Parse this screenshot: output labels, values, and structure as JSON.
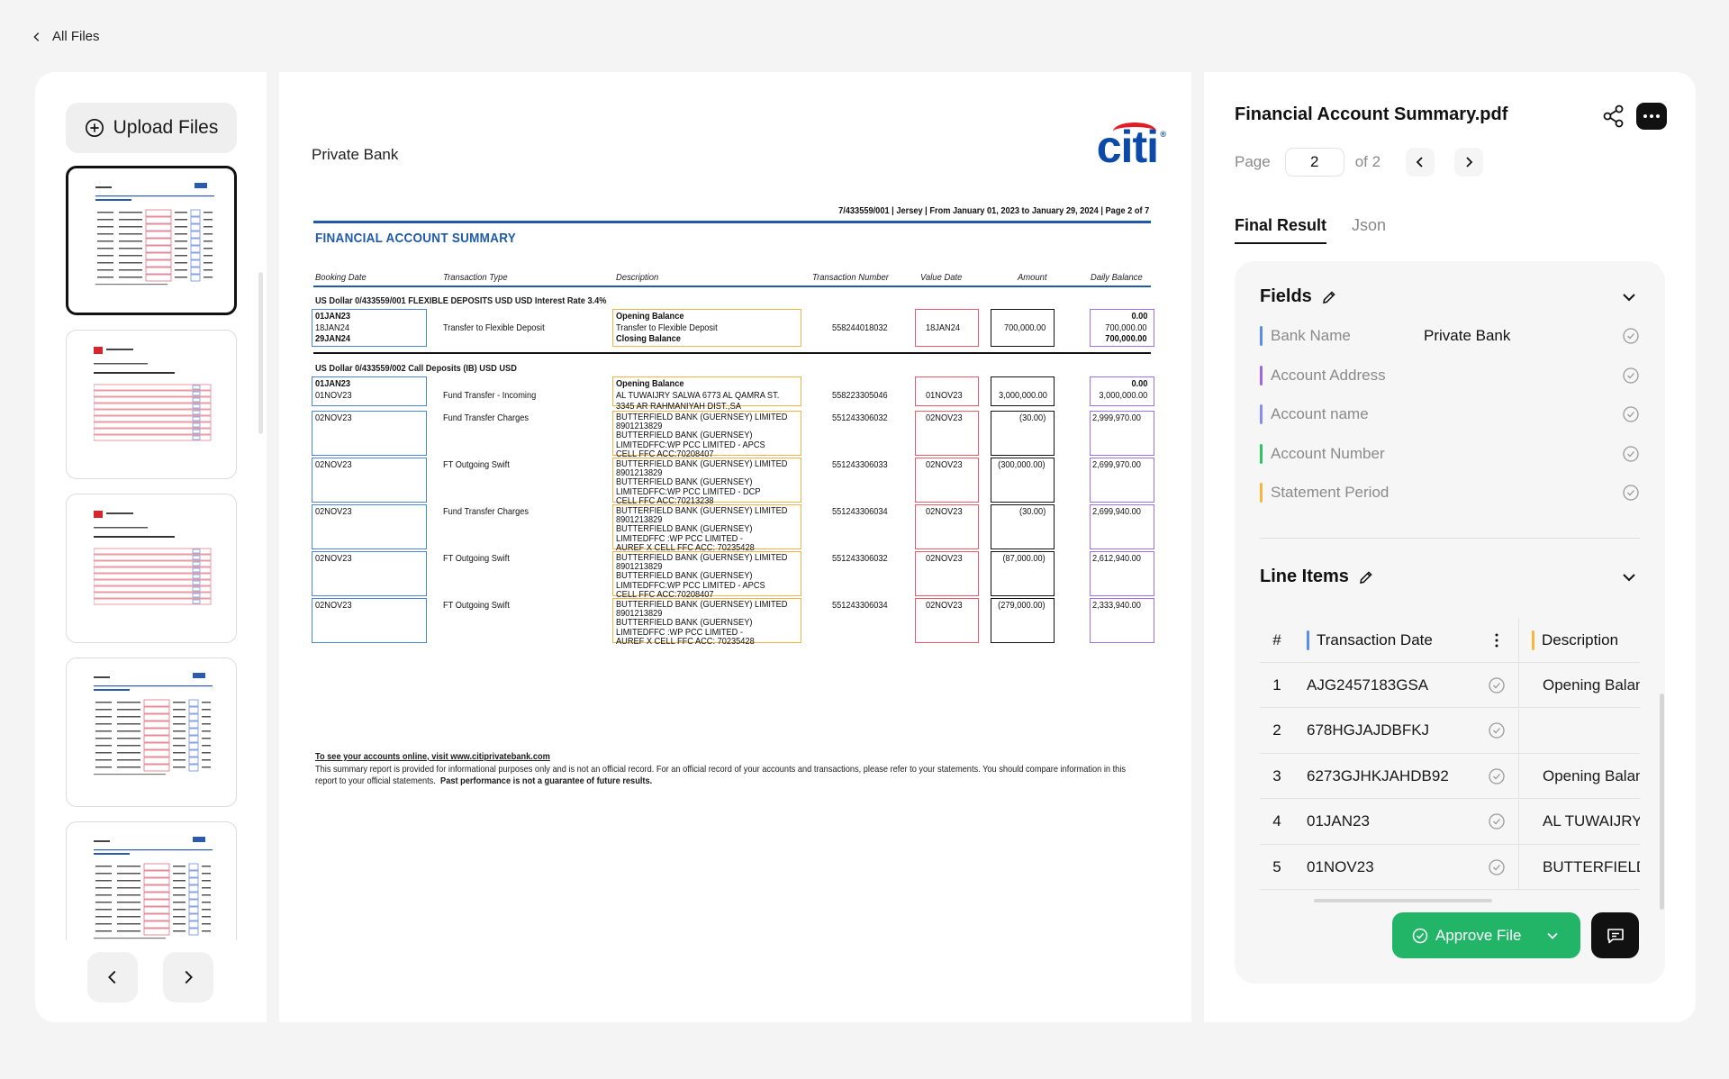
{
  "nav": {
    "back_label": "All Files"
  },
  "left": {
    "upload_label": "Upload Files",
    "thumbnails": [
      {
        "style": "citi"
      },
      {
        "style": "hsbc"
      },
      {
        "style": "hsbc"
      },
      {
        "style": "citi"
      },
      {
        "style": "citi"
      }
    ]
  },
  "document": {
    "private_bank": "Private Bank",
    "logo": "citi",
    "meta": "7/433559/001 | Jersey | From January 01, 2023 to January 29, 2024 | Page 2 of 7",
    "title": "FINANCIAL ACCOUNT SUMMARY",
    "headers": {
      "booking_date": "Booking Date",
      "transaction_type": "Transaction Type",
      "description": "Description",
      "transaction_number": "Transaction Number",
      "value_date": "Value Date",
      "amount": "Amount",
      "daily_balance": "Daily Balance"
    },
    "section1": "US Dollar 0/433559/001 FLEXIBLE DEPOSITS USD     USD Interest Rate 3.4%",
    "s1": {
      "dates": [
        "01JAN23",
        "18JAN24",
        "29JAN24"
      ],
      "type": "Transfer to Flexible Deposit",
      "desc": [
        "Opening Balance",
        "Transfer to Flexible Deposit",
        "Closing Balance"
      ],
      "number": "558244018032",
      "value_date": "18JAN24",
      "amount": "700,000.00",
      "balances": [
        "0.00",
        "700,000.00",
        "700,000.00"
      ]
    },
    "section2": "US Dollar 0/433559/002 Call Deposits (IB) USD     USD",
    "s2_opening": {
      "dates": [
        "01JAN23",
        "01NOV23"
      ],
      "type": "Fund Transfer - Incoming",
      "desc": [
        "Opening Balance",
        "AL TUWAIJRY SALWA 6773 AL QAMRA ST.",
        "3345 AR RAHMANIYAH DIST.,SA"
      ],
      "number": "558223305046",
      "value_date": "01NOV23",
      "amount": "3,000,000.00",
      "balances": [
        "0.00",
        "3,000,000.00"
      ]
    },
    "rows": [
      {
        "date": "02NOV23",
        "type": "Fund Transfer Charges",
        "desc": [
          "BUTTERFIELD BANK (GUERNSEY) LIMITED",
          "8901213829",
          "BUTTERFIELD BANK (GUERNSEY)",
          "LIMITEDFFC:WP PCC LIMITED - APCS",
          "CELL FFC ACC:70208407"
        ],
        "number": "551243306032",
        "value_date": "02NOV23",
        "amount": "(30.00)",
        "balance": "2,999,970.00"
      },
      {
        "date": "02NOV23",
        "type": "FT Outgoing Swift",
        "desc": [
          "BUTTERFIELD BANK (GUERNSEY) LIMITED",
          "8901213829",
          "BUTTERFIELD BANK (GUERNSEY)",
          "LIMITEDFFC:WP PCC LIMITED - DCP",
          "CELL FFC ACC:70213238"
        ],
        "number": "551243306033",
        "value_date": "02NOV23",
        "amount": "(300,000.00)",
        "balance": "2,699,970.00"
      },
      {
        "date": "02NOV23",
        "type": "Fund Transfer Charges",
        "desc": [
          "BUTTERFIELD BANK (GUERNSEY) LIMITED",
          "8901213829",
          "BUTTERFIELD BANK (GUERNSEY)",
          "LIMITEDFFC :WP PCC LIMITED -",
          "AUREF X CELL FFC ACC: 70235428"
        ],
        "number": "551243306034",
        "value_date": "02NOV23",
        "amount": "(30.00)",
        "balance": "2,699,940.00"
      },
      {
        "date": "02NOV23",
        "type": "FT Outgoing Swift",
        "desc": [
          "BUTTERFIELD BANK (GUERNSEY) LIMITED",
          "8901213829",
          "BUTTERFIELD BANK (GUERNSEY)",
          "LIMITEDFFC:WP PCC LIMITED - APCS",
          "CELL FFC ACC:70208407"
        ],
        "number": "551243306032",
        "value_date": "02NOV23",
        "amount": "(87,000.00)",
        "balance": "2,612,940.00"
      },
      {
        "date": "02NOV23",
        "type": "FT Outgoing Swift",
        "desc": [
          "BUTTERFIELD BANK (GUERNSEY) LIMITED",
          "8901213829",
          "BUTTERFIELD BANK (GUERNSEY)",
          "LIMITEDFFC :WP PCC LIMITED -",
          "AUREF X CELL FFC ACC: 70235428"
        ],
        "number": "551243306034",
        "value_date": "02NOV23",
        "amount": "(279,000.00)",
        "balance": "2,333,940.00"
      }
    ],
    "footer_link": "To see your accounts online, visit www.citiprivatebank.com",
    "footer_text": "This summary report is provided for informational purposes only and is not an official record. For an official record of your accounts and transactions, please refer to your statements. You should compare information in this report to your official statements.",
    "footer_bold": "Past performance is not a guarantee of future results."
  },
  "panel": {
    "file_name": "Financial Account Summary.pdf",
    "page_label": "Page",
    "page_value": "2",
    "page_of": "of 2",
    "tabs": [
      "Final Result",
      "Json"
    ],
    "fields_title": "Fields",
    "fields": [
      {
        "label": "Bank Name",
        "value": "Private Bank",
        "color": "#5b8def"
      },
      {
        "label": "Account Address",
        "value": "",
        "color": "#a066e8"
      },
      {
        "label": "Account name",
        "value": "",
        "color": "#8a8cf0"
      },
      {
        "label": "Account Number",
        "value": "",
        "color": "#2fc46a"
      },
      {
        "label": "Statement Period",
        "value": "",
        "color": "#f5b73f"
      }
    ],
    "line_items_title": "Line Items",
    "grid_headers": {
      "num": "#",
      "date": "Transaction Date",
      "desc": "Description"
    },
    "grid_header_colors": {
      "date": "#5b8def",
      "desc": "#f5b73f"
    },
    "grid_rows": [
      {
        "n": "1",
        "date": "AJG2457183GSA",
        "desc": "Opening Balance"
      },
      {
        "n": "2",
        "date": "678HGJAJDBFKJ",
        "desc": ""
      },
      {
        "n": "3",
        "date": "6273GJHKJAHDB92",
        "desc": "Opening Balance"
      },
      {
        "n": "4",
        "date": "01JAN23",
        "desc": "AL TUWAIJRY"
      },
      {
        "n": "5",
        "date": "01NOV23",
        "desc": "BUTTERFIELD"
      }
    ],
    "approve_label": "Approve File"
  }
}
